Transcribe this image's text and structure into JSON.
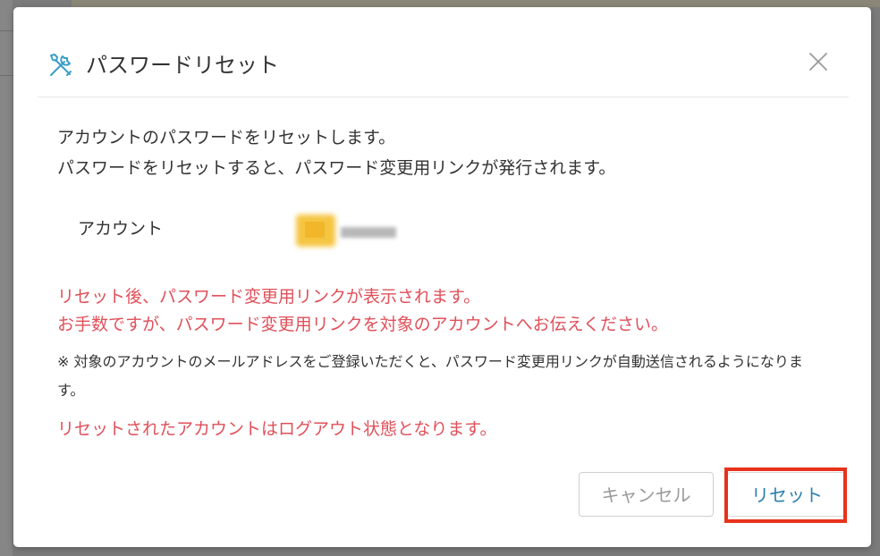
{
  "dialog": {
    "title": "パスワードリセット",
    "title_icon": "tools-icon",
    "close_icon": "close-icon",
    "description": [
      "アカウントのパスワードをリセットします。",
      "パスワードをリセットすると、パスワード変更用リンクが発行されます。"
    ],
    "account_label": "アカウント",
    "warnings": [
      "リセット後、パスワード変更用リンクが表示されます。",
      "お手数ですが、パスワード変更用リンクを対象のアカウントへお伝えください。"
    ],
    "note": "※ 対象のアカウントのメールアドレスをご登録いただくと、パスワード変更用リンクが自動送信されるようになります。",
    "logout_warning": "リセットされたアカウントはログアウト状態となります。",
    "cancel_label": "キャンセル",
    "reset_label": "リセット"
  },
  "colors": {
    "warning": "#e0505a",
    "accent": "#2a7fb0",
    "icon": "#3a9fc8",
    "highlight": "#e8321c"
  }
}
